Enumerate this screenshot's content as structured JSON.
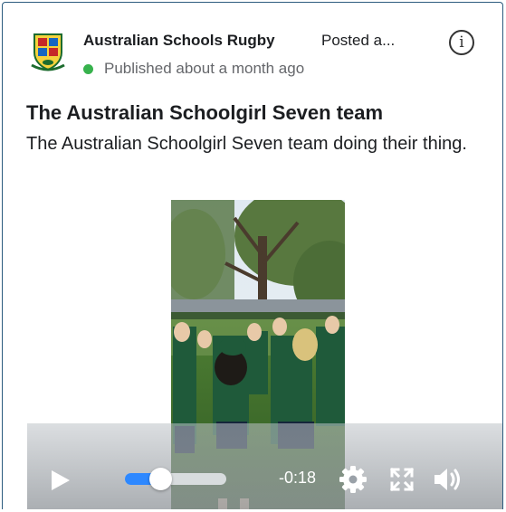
{
  "post": {
    "author": "Australian Schools Rugby",
    "posted_label": "Posted a...",
    "status": "Published about a month ago",
    "status_color": "#37b24d",
    "title": "The Australian Schoolgirl Seven team",
    "body": "The Australian Schoolgirl Seven team doing their thing."
  },
  "video": {
    "time_remaining": "-0:18",
    "progress": 0.35,
    "accent_color": "#2d88ff"
  },
  "icons": {
    "avatar": "rugby-crest-icon",
    "info": "info-icon",
    "play": "play-icon",
    "settings": "gear-icon",
    "fullscreen": "fullscreen-icon",
    "volume": "volume-icon"
  }
}
